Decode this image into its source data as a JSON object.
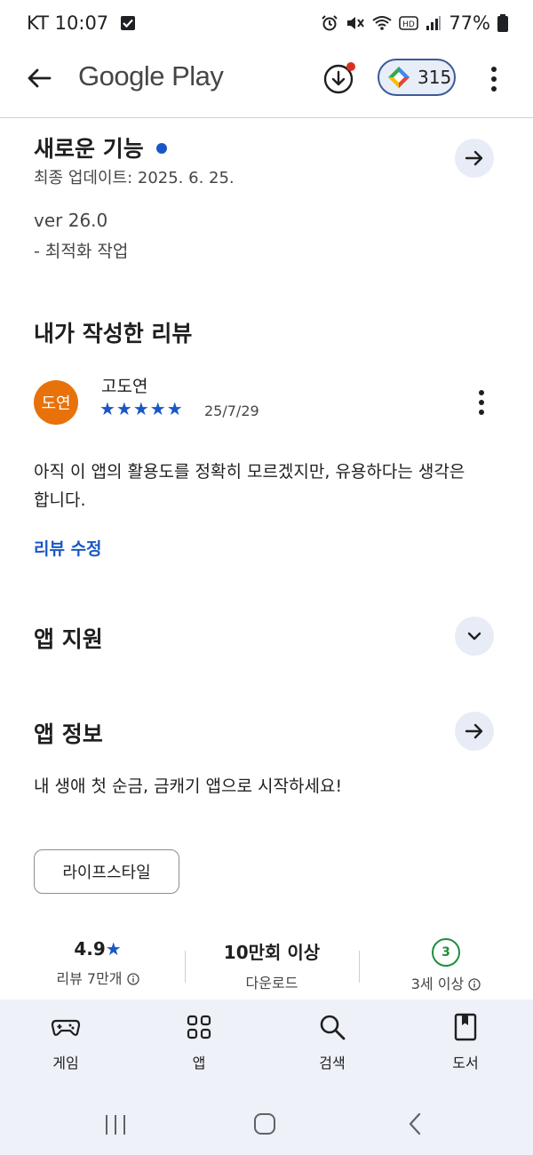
{
  "status_bar": {
    "time": "KT 10:07",
    "battery": "77%"
  },
  "app_bar": {
    "title": "Google Play",
    "points": "315"
  },
  "whats_new": {
    "title": "새로운 기능",
    "updated": "최종 업데이트: 2025. 6. 25.",
    "version": "ver 26.0",
    "note": "- 최적화 작업"
  },
  "my_review": {
    "section_title": "내가 작성한 리뷰",
    "avatar_text": "도연",
    "avatar_color": "#e8710a",
    "author": "고도연",
    "stars": "★★★★★",
    "date": "25/7/29",
    "text_line1": "아직 이 앱의 활용도를 정확히 모르겠지만, 유용하다는 생각은",
    "text_line2": "합니다.",
    "edit_label": "리뷰 수정"
  },
  "app_support": {
    "title": "앱 지원"
  },
  "app_info": {
    "title": "앱 정보",
    "description": "내 생애 첫 순금, 금캐기 앱으로 시작하세요!",
    "category_chip": "라이프스타일"
  },
  "stats": [
    {
      "value": "4.9",
      "label": "리뷰 7만개"
    },
    {
      "value": "10만회 이상",
      "label": "다운로드"
    },
    {
      "value": "3",
      "label": "3세 이상"
    }
  ],
  "bottom_nav": [
    {
      "label": "게임",
      "icon": "gamepad-icon"
    },
    {
      "label": "앱",
      "icon": "apps-grid-icon"
    },
    {
      "label": "검색",
      "icon": "search-icon"
    },
    {
      "label": "도서",
      "icon": "book-icon"
    }
  ],
  "colors": {
    "accent_blue": "#1a57c6",
    "rating_green": "#1e8e3e",
    "nav_bg": "#eef1f8"
  }
}
